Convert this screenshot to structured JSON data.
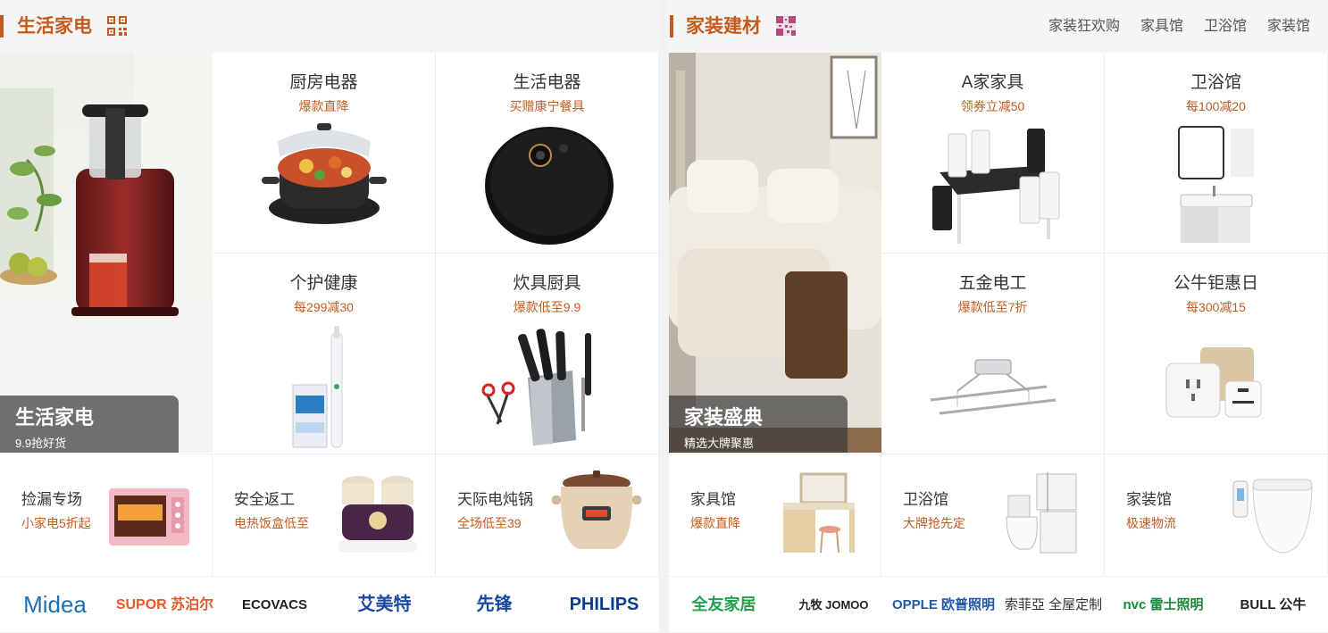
{
  "left": {
    "title": "生活家电",
    "hero": {
      "title": "生活家电",
      "subtitle": "9.9抢好货"
    },
    "cells": [
      {
        "title": "厨房电器",
        "sub": "爆款直降"
      },
      {
        "title": "生活电器",
        "sub": "买赠康宁餐具"
      },
      {
        "title": "个护健康",
        "sub": "每299减30"
      },
      {
        "title": "炊具厨具",
        "sub": "爆款低至9.9"
      }
    ],
    "strip": [
      {
        "title": "捡漏专场",
        "sub": "小家电5折起"
      },
      {
        "title": "安全返工",
        "sub": "电热饭盒低至"
      },
      {
        "title": "天际电炖锅",
        "sub": "全场低至39"
      }
    ],
    "brands": [
      "Midea",
      "SUPOR 苏泊尔",
      "ECOVACS",
      "艾美特",
      "先锋",
      "PHILIPS"
    ]
  },
  "right": {
    "title": "家装建材",
    "links": [
      "家装狂欢购",
      "家具馆",
      "卫浴馆",
      "家装馆"
    ],
    "hero": {
      "title": "家装盛典",
      "subtitle": "精选大牌聚惠"
    },
    "cells": [
      {
        "title": "A家家具",
        "sub": "领券立减50"
      },
      {
        "title": "卫浴馆",
        "sub": "每100减20"
      },
      {
        "title": "五金电工",
        "sub": "爆款低至7折"
      },
      {
        "title": "公牛钜惠日",
        "sub": "每300减15"
      }
    ],
    "strip": [
      {
        "title": "家具馆",
        "sub": "爆款直降"
      },
      {
        "title": "卫浴馆",
        "sub": "大牌抢先定"
      },
      {
        "title": "家装馆",
        "sub": "极速物流"
      }
    ],
    "brands": [
      "全友家居",
      "九牧 JOMOO",
      "OPPLE 欧普照明",
      "索菲亞 全屋定制",
      "nvc 雷士照明",
      "BULL 公牛"
    ]
  },
  "colors": {
    "accent": "#c45b1e"
  }
}
